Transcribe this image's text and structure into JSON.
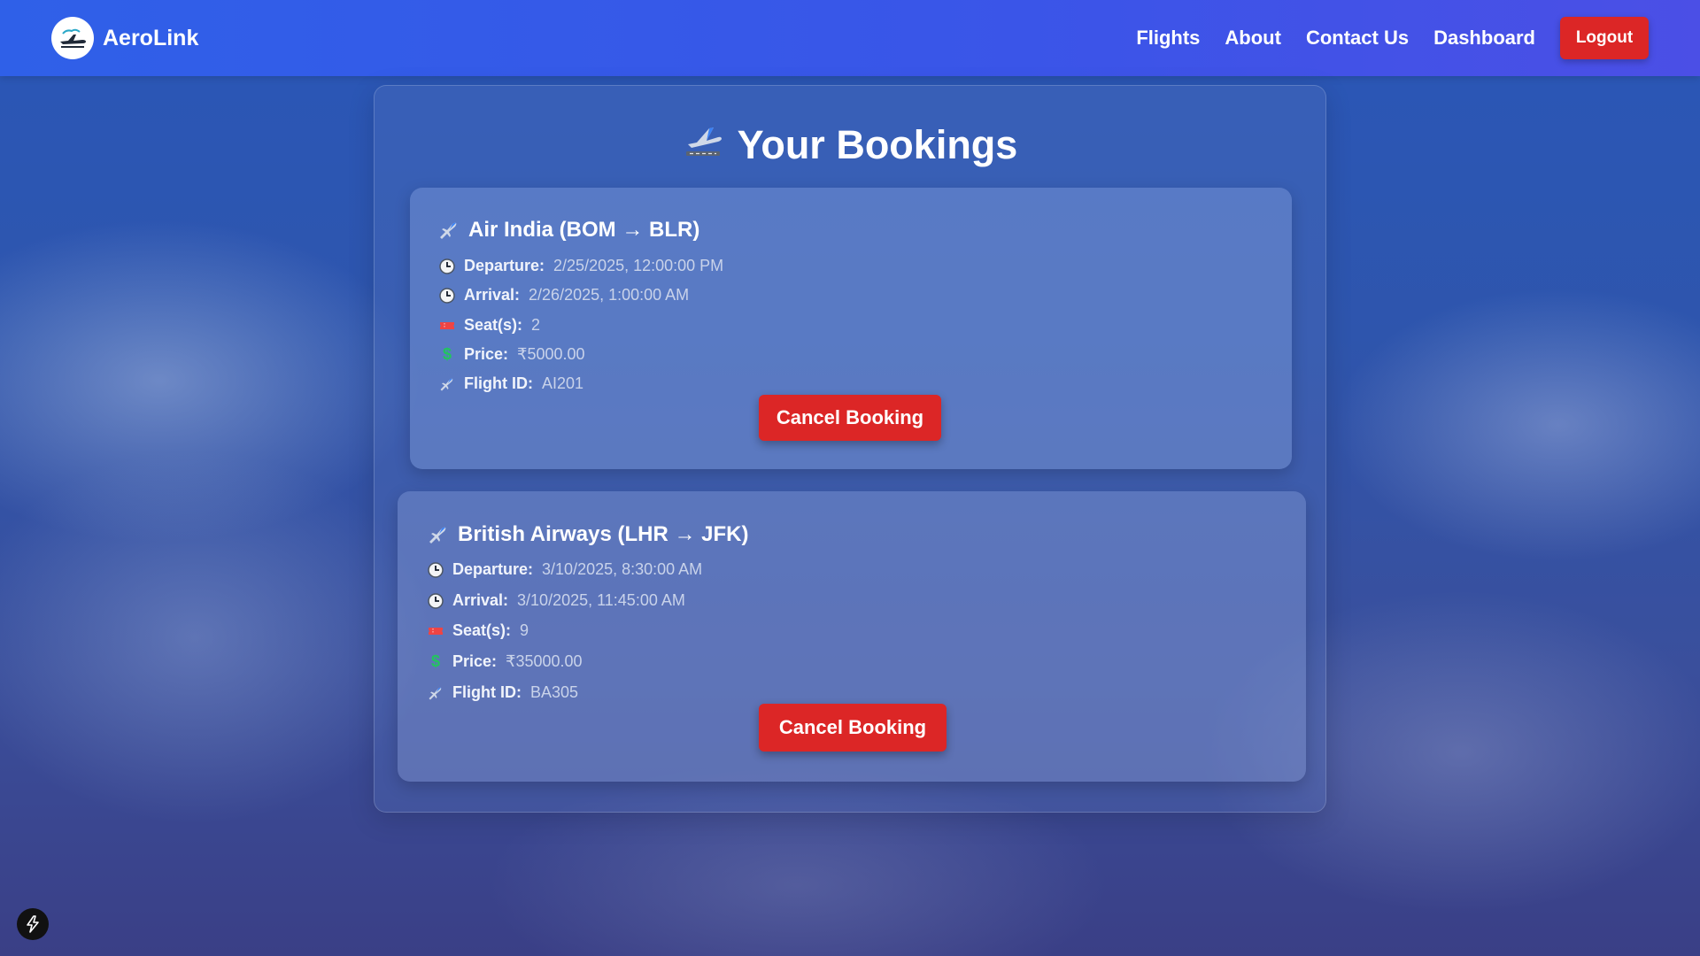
{
  "navbar": {
    "brand_name": "AeroLink",
    "links": [
      {
        "label": "Flights"
      },
      {
        "label": "About"
      },
      {
        "label": "Contact Us"
      },
      {
        "label": "Dashboard"
      }
    ],
    "logout_label": "Logout"
  },
  "page": {
    "title": "Your Bookings"
  },
  "bookings": [
    {
      "title": "Air India (BOM → BLR)",
      "departure_label": "Departure:",
      "departure": "2/25/2025, 12:00:00 PM",
      "arrival_label": "Arrival:",
      "arrival": "2/26/2025, 1:00:00 AM",
      "seats_label": "Seat(s):",
      "seats": "2",
      "price_label": "Price:",
      "price": "₹5000.00",
      "flight_id_label": "Flight ID:",
      "flight_id": "AI201",
      "cancel_label": "Cancel Booking"
    },
    {
      "title": "British Airways (LHR → JFK)",
      "departure_label": "Departure:",
      "departure": "3/10/2025, 8:30:00 AM",
      "arrival_label": "Arrival:",
      "arrival": "3/10/2025, 11:45:00 AM",
      "seats_label": "Seat(s):",
      "seats": "9",
      "price_label": "Price:",
      "price": "₹35000.00",
      "flight_id_label": "Flight ID:",
      "flight_id": "BA305",
      "cancel_label": "Cancel Booking"
    }
  ],
  "colors": {
    "accent": "#dc2626",
    "navbar_start": "#2f60e8",
    "navbar_end": "#4b4fe6",
    "price_icon": "#22c55e",
    "seat_icon": "#ef4444"
  },
  "icons": {
    "brand": "airplane-logo-icon",
    "title": "airplane-departure-icon",
    "card_title": "airplane-icon",
    "departure": "clock-icon",
    "arrival": "clock-icon",
    "seats": "ticket-icon",
    "price": "dollar-icon",
    "flight_id": "airplane-icon",
    "badge": "lightning-icon"
  }
}
